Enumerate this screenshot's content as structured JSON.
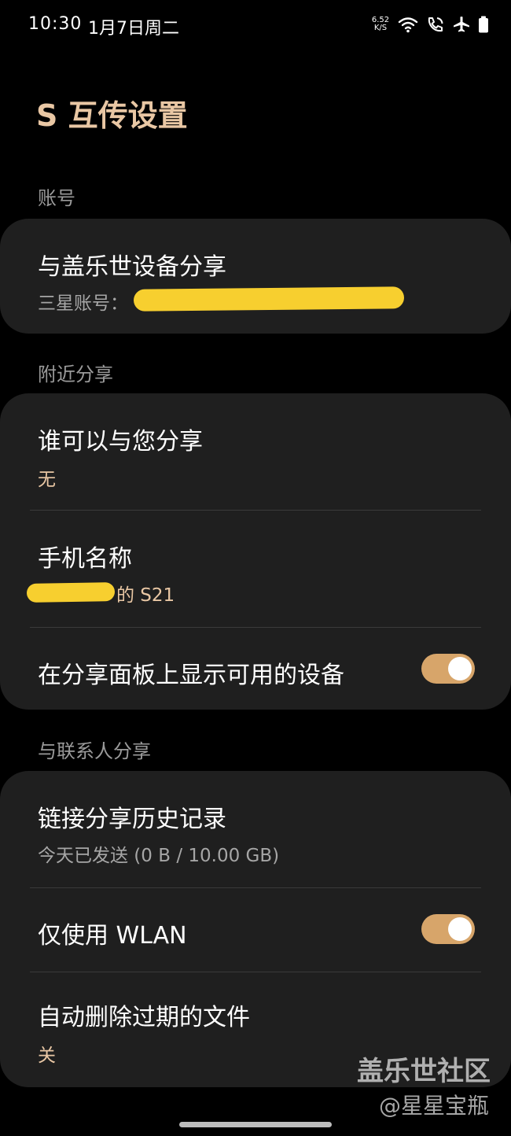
{
  "status_bar": {
    "time": "10:30",
    "date": "1月7日周二",
    "net_speed_value": "6.52",
    "net_speed_unit": "K/S"
  },
  "header": {
    "title": "S 互传设置"
  },
  "sections": {
    "account": {
      "header": "账号",
      "galaxy_share": {
        "title": "与盖乐世设备分享",
        "subtitle": "三星账号："
      }
    },
    "nearby": {
      "header": "附近分享",
      "who_can_share": {
        "title": "谁可以与您分享",
        "value": "无"
      },
      "phone_name": {
        "title": "手机名称",
        "value": "的 S21"
      },
      "show_devices": {
        "title": "在分享面板上显示可用的设备",
        "enabled": true
      }
    },
    "contacts": {
      "header": "与联系人分享",
      "link_history": {
        "title": "链接分享历史记录",
        "subtitle": "今天已发送 (0 B / 10.00 GB)"
      },
      "wlan_only": {
        "title": "仅使用 WLAN",
        "enabled": true
      },
      "auto_delete": {
        "title": "自动删除过期的文件",
        "value": "关"
      }
    }
  },
  "watermark": {
    "line1": "盖乐世社区",
    "line2": "@星星宝瓶"
  },
  "colors": {
    "accent": "#e9c7a4",
    "toggle_on": "#d7a56a",
    "card_bg": "#1f1f1f",
    "redaction": "#f7cf2f"
  }
}
